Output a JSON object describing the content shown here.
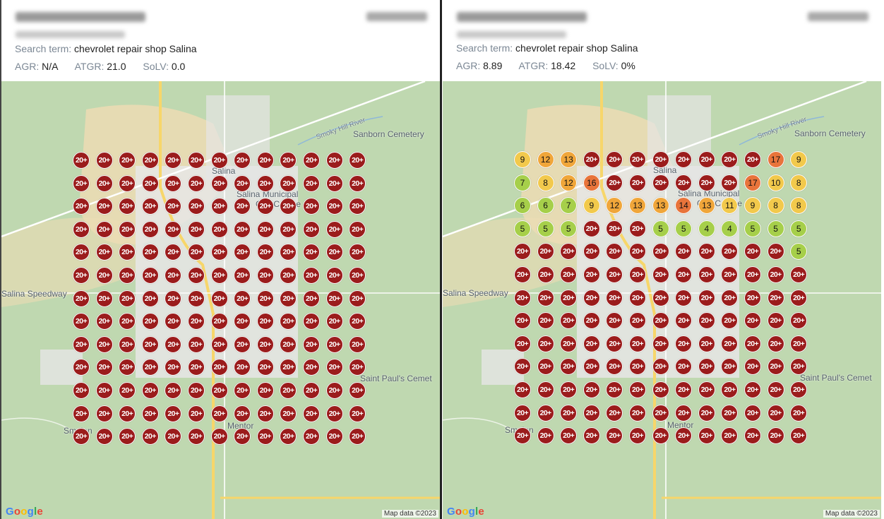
{
  "panels": [
    {
      "search_label": "Search term:",
      "search_term": "chevrolet repair shop Salina",
      "metrics": [
        {
          "label": "AGR:",
          "value": "N/A"
        },
        {
          "label": "ATGR:",
          "value": "21.0"
        },
        {
          "label": "SoLV:",
          "value": "0.0"
        }
      ],
      "grid": [
        [
          "20+",
          "20+",
          "20+",
          "20+",
          "20+",
          "20+",
          "20+",
          "20+",
          "20+",
          "20+",
          "20+",
          "20+",
          "20+"
        ],
        [
          "20+",
          "20+",
          "20+",
          "20+",
          "20+",
          "20+",
          "20+",
          "20+",
          "20+",
          "20+",
          "20+",
          "20+",
          "20+"
        ],
        [
          "20+",
          "20+",
          "20+",
          "20+",
          "20+",
          "20+",
          "20+",
          "20+",
          "20+",
          "20+",
          "20+",
          "20+",
          "20+"
        ],
        [
          "20+",
          "20+",
          "20+",
          "20+",
          "20+",
          "20+",
          "20+",
          "20+",
          "20+",
          "20+",
          "20+",
          "20+",
          "20+"
        ],
        [
          "20+",
          "20+",
          "20+",
          "20+",
          "20+",
          "20+",
          "20+",
          "20+",
          "20+",
          "20+",
          "20+",
          "20+",
          "20+"
        ],
        [
          "20+",
          "20+",
          "20+",
          "20+",
          "20+",
          "20+",
          "20+",
          "20+",
          "20+",
          "20+",
          "20+",
          "20+",
          "20+"
        ],
        [
          "20+",
          "20+",
          "20+",
          "20+",
          "20+",
          "20+",
          "20+",
          "20+",
          "20+",
          "20+",
          "20+",
          "20+",
          "20+"
        ],
        [
          "20+",
          "20+",
          "20+",
          "20+",
          "20+",
          "20+",
          "20+",
          "20+",
          "20+",
          "20+",
          "20+",
          "20+",
          "20+"
        ],
        [
          "20+",
          "20+",
          "20+",
          "20+",
          "20+",
          "20+",
          "20+",
          "20+",
          "20+",
          "20+",
          "20+",
          "20+",
          "20+"
        ],
        [
          "20+",
          "20+",
          "20+",
          "20+",
          "20+",
          "20+",
          "20+",
          "20+",
          "20+",
          "20+",
          "20+",
          "20+",
          "20+"
        ],
        [
          "20+",
          "20+",
          "20+",
          "20+",
          "20+",
          "20+",
          "20+",
          "20+",
          "20+",
          "20+",
          "20+",
          "20+",
          "20+"
        ],
        [
          "20+",
          "20+",
          "20+",
          "20+",
          "20+",
          "20+",
          "20+",
          "20+",
          "20+",
          "20+",
          "20+",
          "20+",
          "20+"
        ],
        [
          "20+",
          "20+",
          "20+",
          "20+",
          "20+",
          "20+",
          "20+",
          "20+",
          "20+",
          "20+",
          "20+",
          "20+",
          "20+"
        ]
      ]
    },
    {
      "search_label": "Search term:",
      "search_term": "chevrolet repair shop Salina",
      "metrics": [
        {
          "label": "AGR:",
          "value": "8.89"
        },
        {
          "label": "ATGR:",
          "value": "18.42"
        },
        {
          "label": "SoLV:",
          "value": "0%"
        }
      ],
      "grid": [
        [
          "9",
          "12",
          "13",
          "20+",
          "20+",
          "20+",
          "20+",
          "20+",
          "20+",
          "20+",
          "20+",
          "17",
          "9"
        ],
        [
          "7",
          "8",
          "12",
          "16",
          "20+",
          "20+",
          "20+",
          "20+",
          "20+",
          "20+",
          "17",
          "10",
          "8"
        ],
        [
          "6",
          "6",
          "7",
          "9",
          "12",
          "13",
          "13",
          "14",
          "13",
          "11",
          "9",
          "8",
          "8"
        ],
        [
          "5",
          "5",
          "5",
          "20+",
          "20+",
          "20+",
          "5",
          "5",
          "4",
          "4",
          "5",
          "5",
          "5"
        ],
        [
          "20+",
          "20+",
          "20+",
          "20+",
          "20+",
          "20+",
          "20+",
          "20+",
          "20+",
          "20+",
          "20+",
          "20+",
          "5"
        ],
        [
          "20+",
          "20+",
          "20+",
          "20+",
          "20+",
          "20+",
          "20+",
          "20+",
          "20+",
          "20+",
          "20+",
          "20+",
          "20+"
        ],
        [
          "20+",
          "20+",
          "20+",
          "20+",
          "20+",
          "20+",
          "20+",
          "20+",
          "20+",
          "20+",
          "20+",
          "20+",
          "20+"
        ],
        [
          "20+",
          "20+",
          "20+",
          "20+",
          "20+",
          "20+",
          "20+",
          "20+",
          "20+",
          "20+",
          "20+",
          "20+",
          "20+"
        ],
        [
          "20+",
          "20+",
          "20+",
          "20+",
          "20+",
          "20+",
          "20+",
          "20+",
          "20+",
          "20+",
          "20+",
          "20+",
          "20+"
        ],
        [
          "20+",
          "20+",
          "20+",
          "20+",
          "20+",
          "20+",
          "20+",
          "20+",
          "20+",
          "20+",
          "20+",
          "20+",
          "20+"
        ],
        [
          "20+",
          "20+",
          "20+",
          "20+",
          "20+",
          "20+",
          "20+",
          "20+",
          "20+",
          "20+",
          "20+",
          "20+",
          "20+"
        ],
        [
          "20+",
          "20+",
          "20+",
          "20+",
          "20+",
          "20+",
          "20+",
          "20+",
          "20+",
          "20+",
          "20+",
          "20+",
          "20+"
        ],
        [
          "20+",
          "20+",
          "20+",
          "20+",
          "20+",
          "20+",
          "20+",
          "20+",
          "20+",
          "20+",
          "20+",
          "20+",
          "20+"
        ]
      ]
    }
  ],
  "map_labels": {
    "sanborn": "Sanborn Cemetery",
    "smoky": "Smoky Hill River",
    "salina": "Salina",
    "municipal": "Salina Municipal",
    "course": "Golf Course",
    "speedway": "Salina Speedway",
    "saint_pauls": "Saint Paul's Cemet",
    "mentor": "Mentor",
    "smolan": "Smolan"
  },
  "attribution": {
    "google": "Google",
    "map_data": "Map data ©2023"
  },
  "colors": {
    "rank_20_plus": "#9b1c1c",
    "rank_green": "#a6cf4a",
    "rank_yellow": "#f2c94c",
    "rank_orange_light": "#f0a63a",
    "rank_orange": "#e8743b",
    "map_base": "#bfd8b0",
    "urban": "#e6e6e6",
    "sand": "#ecdcb4",
    "road_major": "#f7d66a"
  }
}
